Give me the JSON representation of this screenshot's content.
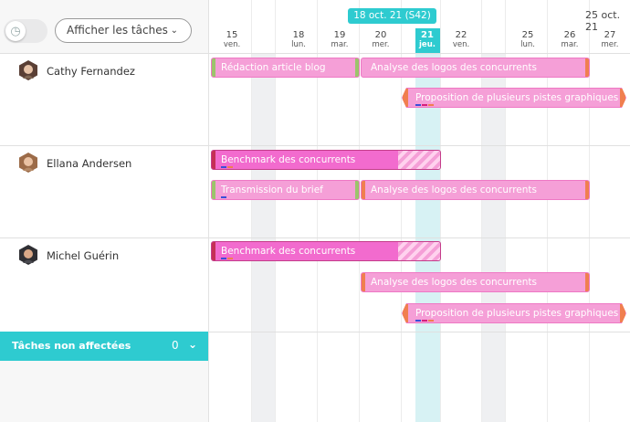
{
  "toolbar": {
    "show_tasks_label": "Afficher les tâches",
    "clock_icon": "clock-icon"
  },
  "people": [
    {
      "name": "Cathy Fernandez"
    },
    {
      "name": "Ellana Andersen"
    },
    {
      "name": "Michel Guérin"
    }
  ],
  "unassigned": {
    "label": "Tâches non affectées",
    "count": "0"
  },
  "timeline": {
    "week_label": "18 oct. 21 (S42)",
    "next_week_label": "25 oct. 21",
    "days": [
      {
        "num": "15",
        "name": "ven."
      },
      {
        "num": "18",
        "name": "lun."
      },
      {
        "num": "19",
        "name": "mar."
      },
      {
        "num": "20",
        "name": "mer."
      },
      {
        "num": "21",
        "name": "jeu."
      },
      {
        "num": "22",
        "name": "ven."
      },
      {
        "num": "25",
        "name": "lun."
      },
      {
        "num": "26",
        "name": "mar."
      },
      {
        "num": "27",
        "name": "mer."
      }
    ]
  },
  "tasks": {
    "cathy_1": "Rédaction article blog",
    "cathy_2": "Analyse des logos des concurrents",
    "cathy_3": "Proposition de plusieurs pistes graphiques",
    "ellana_1": "Benchmark des concurrents",
    "ellana_2": "Transmission du brief",
    "ellana_3": "Analyse des logos des concurrents",
    "michel_1": "Benchmark des concurrents",
    "michel_2": "Analyse des logos des concurrents",
    "michel_3": "Proposition de plusieurs pistes graphiques"
  },
  "colors": {
    "accent": "#2ecbd0",
    "task_light": "#f59fd7",
    "task_dark": "#f26bce",
    "edge_green": "#9cc46b",
    "edge_orange": "#f07f4f",
    "edge_red": "#c53055"
  }
}
